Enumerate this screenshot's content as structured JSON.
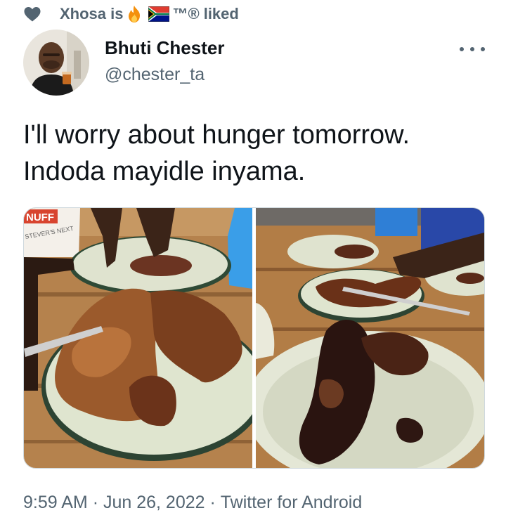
{
  "social_context": {
    "user": "Xhosa is",
    "trademark": "™®",
    "action": "liked",
    "icons": [
      "heart-icon",
      "fire-emoji",
      "south-africa-flag-emoji"
    ]
  },
  "author": {
    "name": "Bhuti Chester",
    "handle": "@chester_ta"
  },
  "tweet": {
    "lines": [
      "I'll worry about hunger tomorrow.",
      "Indoda mayidle inyama."
    ]
  },
  "media": {
    "photo_count": 2,
    "photo1_text": {
      "brand": "NUFF",
      "tag": "STEVER'S NEXT"
    }
  },
  "meta": {
    "time": "9:59 AM",
    "separator": "·",
    "date": "Jun 26, 2022",
    "source": "Twitter for Android"
  },
  "colors": {
    "primary_text": "#0f1419",
    "secondary_text": "#536471",
    "border": "#cfd9de"
  }
}
